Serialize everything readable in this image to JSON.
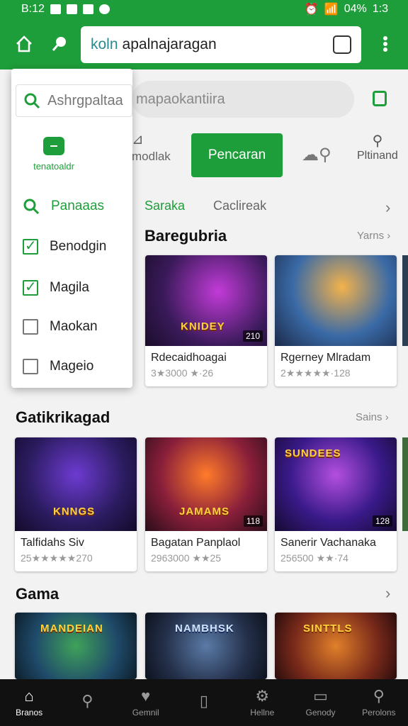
{
  "status_bar": {
    "time": "B:12",
    "battery": "04%",
    "clock_right": "1:3"
  },
  "top_bar": {
    "url_prefix": "koln",
    "url_text": "apalnajaragan"
  },
  "search_row": {
    "placeholder": "mapaokantiira"
  },
  "action_row": {
    "left_label": "modlak",
    "primary_button": "Pencaran",
    "right_label": "Pltinand"
  },
  "chips": {
    "active": "Saraka",
    "inactive": "Caclireak"
  },
  "overlay_panel": {
    "search_placeholder": "Ashrgpaltaa",
    "brand_label": "tenatoaldr",
    "items": [
      {
        "label": "Panaaas",
        "type": "search"
      },
      {
        "label": "Benodgin",
        "checked": true
      },
      {
        "label": "Magila",
        "checked": true
      },
      {
        "label": "Maokan",
        "checked": false
      },
      {
        "label": "Mageio",
        "checked": false
      }
    ]
  },
  "section1": {
    "title": "Baregubria",
    "see_all": "Yarns",
    "cards": [
      {
        "title": "Rdecaidhoagai",
        "meta": "3★3000 ★·26",
        "badge": "210",
        "logo": "KNIDEY"
      },
      {
        "title": "Rgerney Mlradam",
        "meta": "2★★★★★·128",
        "badge": "",
        "logo": ""
      }
    ]
  },
  "section2": {
    "title": "Gatikrikagad",
    "see_all": "Sains",
    "cards": [
      {
        "title": "Talfidahs Siv",
        "meta": "25★★★★★270",
        "badge": "",
        "logo": "KNNGS"
      },
      {
        "title": "Bagatan Panplaol",
        "meta": "2963000 ★★25",
        "badge": "118",
        "logo": "JAMAMS"
      },
      {
        "title": "Sanerir Vachanaka",
        "meta": "256500 ★★·74",
        "badge": "128",
        "logo": "SUNDEES"
      }
    ]
  },
  "section3": {
    "title": "Gama",
    "cards": [
      {
        "logo": "MANDEIAN"
      },
      {
        "logo": "NAMBHSK"
      },
      {
        "logo": "SINTTLS"
      }
    ]
  },
  "bottom_nav": [
    {
      "label": "Branos",
      "icon": "home-icon",
      "active": true
    },
    {
      "label": "",
      "icon": "search-icon",
      "active": false
    },
    {
      "label": "Gemnil",
      "icon": "heart-icon",
      "active": false
    },
    {
      "label": "",
      "icon": "bookmark-icon",
      "active": false
    },
    {
      "label": "Hellne",
      "icon": "gear-icon",
      "active": false
    },
    {
      "label": "Genody",
      "icon": "tablet-icon",
      "active": false
    },
    {
      "label": "Perolons",
      "icon": "profile-icon",
      "active": false
    }
  ],
  "colors": {
    "brand": "#1e9e3a",
    "nav_bg": "#111111"
  }
}
